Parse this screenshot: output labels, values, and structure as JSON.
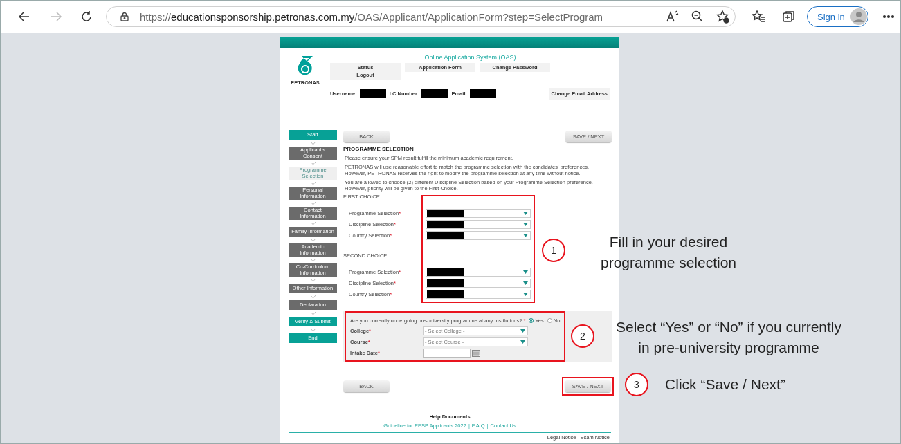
{
  "browser": {
    "url_scheme": "https://",
    "url_host": "educationsponsorship.petronas.com.my",
    "url_path": "/OAS/Applicant/ApplicationForm?step=SelectProgram",
    "sign_in": "Sign in"
  },
  "header": {
    "logo_text": "PETRONAS",
    "title": "Online Application System (OAS)",
    "nav": [
      [
        "Status",
        "Logout"
      ],
      [
        "Application Form"
      ],
      [
        "Change Password"
      ]
    ],
    "user_fields": [
      {
        "label": "Username :",
        "redacted": true
      },
      {
        "label": "I.C Number :",
        "redacted": true
      },
      {
        "label": "Email :",
        "redacted": true
      }
    ],
    "change_email": "Change Email Address"
  },
  "steps": [
    {
      "label": "Start",
      "kind": "terminal",
      "selected": false
    },
    {
      "label": "Applicant's Consent",
      "kind": "section",
      "selected": false
    },
    {
      "label": "Programme Selection",
      "kind": "section",
      "selected": true
    },
    {
      "label": "Personal Information",
      "kind": "section",
      "selected": false
    },
    {
      "label": "Contact Information",
      "kind": "section",
      "selected": false
    },
    {
      "label": "Family Information",
      "kind": "section",
      "selected": false
    },
    {
      "label": "Academic Information",
      "kind": "section",
      "selected": false
    },
    {
      "label": "Co-Curriculum Information",
      "kind": "section",
      "selected": false
    },
    {
      "label": "Other Information",
      "kind": "section",
      "selected": false
    },
    {
      "label": "Declaration",
      "kind": "section",
      "selected": false
    },
    {
      "label": "Verify & Submit",
      "kind": "terminal",
      "selected": false
    },
    {
      "label": "End",
      "kind": "terminal",
      "selected": false
    }
  ],
  "top_buttons": {
    "back": "BACK",
    "save": "SAVE / NEXT"
  },
  "section_title": "PROGRAMME SELECTION",
  "notes": [
    "Please ensure your SPM result fulfill the minimum academic requirement.",
    "PETRONAS will use reasonable effort to match the programme selection with the candidates' preferences. However, PETRONAS reserves the right to modify the programme selection at any time without notice.",
    "You are allowed to choose (2) different Discipline Selection based on your Programme Selection preference. However, priority will be given to the First Choice."
  ],
  "choices": [
    {
      "title": "FIRST CHOICE",
      "fields": [
        {
          "label": "Programme Selection",
          "required_mark": "*",
          "redacted": true
        },
        {
          "label": "Discipline Selection",
          "required_mark": "*",
          "redacted": true
        },
        {
          "label": "Country Selection",
          "required_mark": "*",
          "redacted": true
        }
      ]
    },
    {
      "title": "SECOND CHOICE",
      "fields": [
        {
          "label": "Programme Selection",
          "required_mark": "*",
          "redacted": true
        },
        {
          "label": "Discipline Selection",
          "required_mark": "*",
          "redacted": true
        },
        {
          "label": "Country Selection",
          "required_mark": "*",
          "redacted": true
        }
      ]
    }
  ],
  "pre_university": {
    "question": "Are you currently undergoing pre-university programme at any Institutions?",
    "required_mark": "*",
    "options": [
      {
        "label": "Yes",
        "selected": true
      },
      {
        "label": "No",
        "selected": false
      }
    ],
    "fields": [
      {
        "kind": "select",
        "label": "College",
        "required_mark": "*",
        "placeholder": "- Select College -"
      },
      {
        "kind": "select",
        "label": "Course",
        "required_mark": "*",
        "placeholder": "- Select Course -"
      },
      {
        "kind": "date",
        "label": "Intake Date",
        "required_mark": "*"
      }
    ]
  },
  "bottom_buttons": {
    "back": "BACK",
    "save": "SAVE / NEXT"
  },
  "footer": {
    "help_title": "Help Documents",
    "links": [
      "Guideline for PESP Applicants 2022",
      "F.A.Q",
      "Contact Us"
    ],
    "separator": "|",
    "notices": [
      "Legal Notice",
      "Scam Notice"
    ]
  },
  "annotations": [
    {
      "number": "1",
      "lines": [
        "Fill in your desired",
        "programme selection"
      ]
    },
    {
      "number": "2",
      "lines": [
        "Select “Yes” or “No” if you currently",
        "in pre-university programme"
      ]
    },
    {
      "number": "3",
      "lines": [
        "Click “Save / Next”"
      ]
    }
  ]
}
